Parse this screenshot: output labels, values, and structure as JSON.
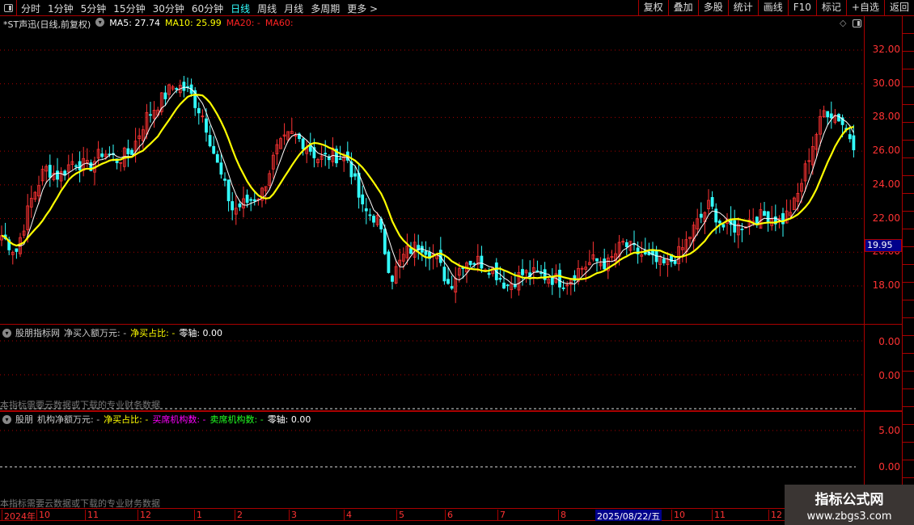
{
  "toolbar": {
    "periods": [
      "分时",
      "1分钟",
      "5分钟",
      "15分钟",
      "30分钟",
      "60分钟",
      "日线",
      "周线",
      "月线",
      "多周期",
      "更多 >"
    ],
    "active_period": "日线",
    "tools": [
      "复权",
      "叠加",
      "多股",
      "统计",
      "画线",
      "F10",
      "标记",
      "+自选",
      "返回"
    ]
  },
  "main": {
    "stock": "*ST声迅(日线,前复权)",
    "ma5": "MA5: 27.74",
    "ma10": "MA10: 25.99",
    "ma20": "MA20: -",
    "ma60": "MA60:",
    "y_ticks": [
      "32.00",
      "30.00",
      "28.00",
      "26.00",
      "24.00",
      "22.00",
      "20.00",
      "18.00"
    ],
    "current_price": "19.95"
  },
  "panel1": {
    "name": "股朋指标网",
    "f1": "净买入额万元: -",
    "f2": "净买占比: -",
    "f3": "零轴: 0.00",
    "ticks": [
      "0.00",
      "0.00"
    ],
    "note": "本指标需要云数据或下载的专业财务数据"
  },
  "panel2": {
    "name": "股朋",
    "f1": "机构净额万元: -",
    "f2": "净买占比: -",
    "f3": "买席机构数: -",
    "f4": "卖席机构数: -",
    "f5": "零轴: 0.00",
    "ticks": [
      "5.00",
      "0.00"
    ],
    "note": "本指标需要云数据或下载的专业财务数据"
  },
  "date_axis": {
    "labels": [
      "2024年",
      "10",
      "11",
      "12",
      "1",
      "2",
      "3",
      "4",
      "5",
      "6",
      "7",
      "8",
      "2025/08/22/五",
      "10",
      "11",
      "12"
    ]
  },
  "watermark": {
    "title": "指标公式网",
    "url": "www.zbgs3.com"
  },
  "colors": {
    "up": "#ff3333",
    "down": "#33ffff",
    "ma5": "#ffffff",
    "ma10": "#ffff00",
    "grid": "#aa0000"
  },
  "chart_data": {
    "type": "candlestick",
    "ylim": [
      16.5,
      33
    ],
    "approx_close_path": [
      21,
      20,
      23,
      25,
      24.5,
      25.5,
      25,
      26,
      25.5,
      26,
      28,
      29,
      30,
      29.5,
      28,
      25,
      22.5,
      23,
      23.5,
      26,
      27,
      26.5,
      25.5,
      25.8,
      25.5,
      22.5,
      22,
      18.5,
      20,
      20.5,
      19.8,
      18,
      19.5,
      19.5,
      19,
      18,
      18.7,
      18.7,
      18.5,
      18.2,
      19,
      19.5,
      19.3,
      20.5,
      20,
      19.5,
      19.2,
      20,
      21.5,
      22.8,
      21.5,
      21.5,
      22,
      22.2,
      21.8,
      23,
      26,
      28.5,
      28,
      26.5
    ]
  }
}
